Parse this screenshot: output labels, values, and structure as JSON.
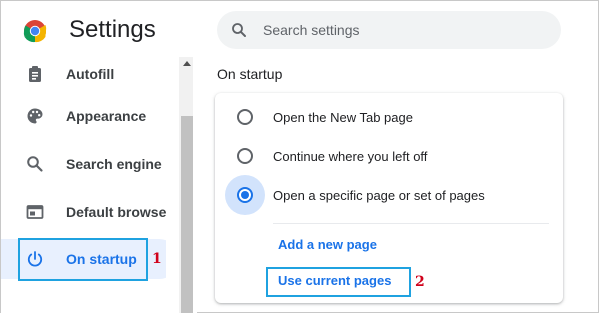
{
  "app": {
    "title": "Settings"
  },
  "search": {
    "placeholder": "Search settings"
  },
  "sidebar": {
    "items": [
      {
        "label": "Autofill",
        "icon": "clipboard-icon"
      },
      {
        "label": "Appearance",
        "icon": "palette-icon"
      },
      {
        "label": "Search engine",
        "icon": "search-icon"
      },
      {
        "label": "Default browser",
        "icon": "browser-icon"
      },
      {
        "label": "On startup",
        "icon": "power-icon",
        "active": true
      }
    ]
  },
  "main": {
    "section_title": "On startup",
    "options": [
      {
        "label": "Open the New Tab page",
        "selected": false
      },
      {
        "label": "Continue where you left off",
        "selected": false
      },
      {
        "label": "Open a specific page or set of pages",
        "selected": true
      }
    ],
    "links": {
      "add_page": "Add a new page",
      "use_current": "Use current pages"
    }
  },
  "annotations": {
    "step1": "1",
    "step2": "2"
  },
  "colors": {
    "accent": "#1a73e8",
    "active_bg": "#e8f0fe",
    "callout": "#1fa2e0",
    "callout_number": "#d0021b"
  }
}
